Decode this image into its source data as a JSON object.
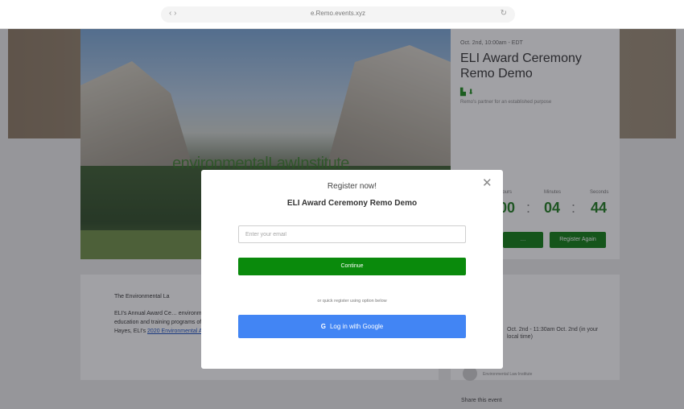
{
  "browser": {
    "nav_glyph": "‹ ›",
    "url": "e.Remo.events.xyz",
    "refresh_glyph": "↻"
  },
  "hero": {
    "watermark": "environmentalLawInstitute"
  },
  "event": {
    "date": "Oct. 2nd, 10:00am - EDT",
    "title": "ELI Award Ceremony Remo Demo",
    "icons": "▙ ⬇",
    "host": "Remo's partner for an established purpose",
    "countdown": {
      "labels": [
        "Hours",
        "Minutes",
        "Seconds"
      ],
      "hours": "00",
      "minutes": "04",
      "seconds": "44"
    },
    "buttons": {
      "left": "…",
      "right": "Register Again"
    }
  },
  "description": {
    "para1": "The Environmental La",
    "para2": "ELI's Annual Award Ce… environmental profess… of cooperation while supporting the agenda-setting research, education and training programs of the Institute. Tune in to the streamed global program, in conversation with Davis Hayes, ELI's",
    "link": "2020 Environmental Achievement Award Winner."
  },
  "side": {
    "time": "Oct. 2nd - 11:30am Oct. 2nd (in your local time)",
    "org": "Environmental Law Institute",
    "share": "Share this event"
  },
  "modal": {
    "close_glyph": "✕",
    "title": "Register now!",
    "subtitle": "ELI Award Ceremony Remo Demo",
    "email_placeholder": "Enter your email",
    "continue_label": "Continue",
    "or_text": "or quick register using option below",
    "google_glyph": "G",
    "google_label": "Log in with Google"
  },
  "colors": {
    "accent_green": "#0a8a0c",
    "google_blue": "#4285f4",
    "countdown_green": "#1f7d1f"
  }
}
